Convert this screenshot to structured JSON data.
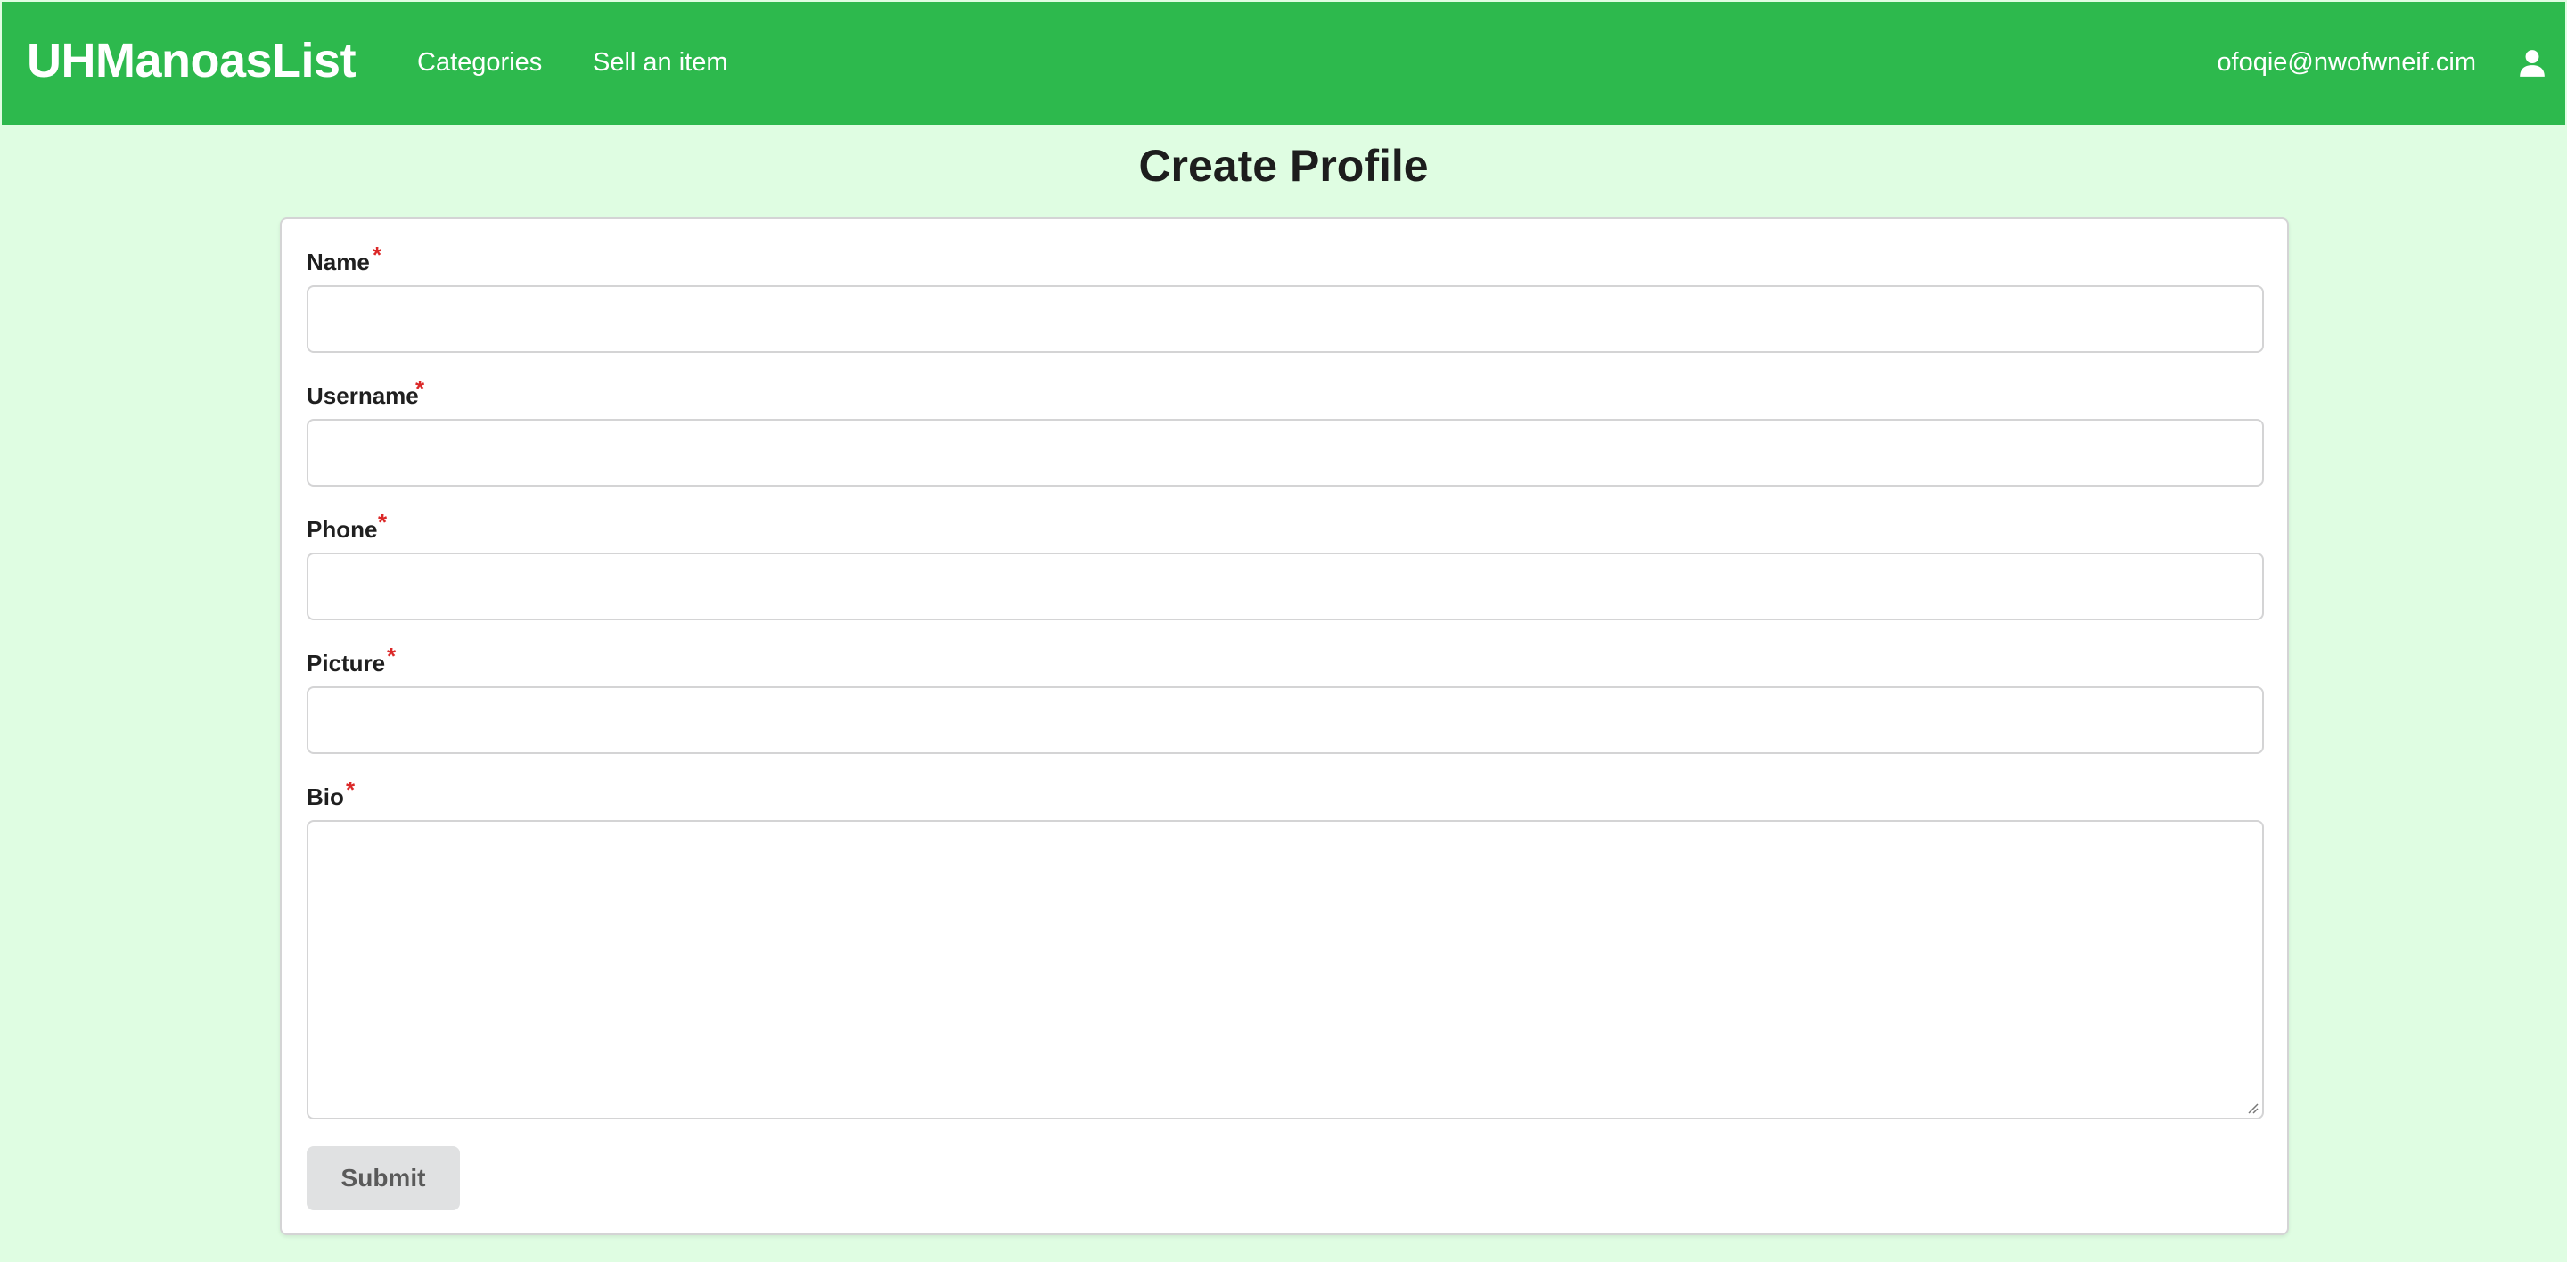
{
  "navbar": {
    "brand": "UHManoasList",
    "links": [
      {
        "label": "Categories"
      },
      {
        "label": "Sell an item"
      }
    ],
    "user_email": "ofoqie@nwofwneif.cim",
    "user_icon": "user-icon"
  },
  "page": {
    "title": "Create Profile"
  },
  "form": {
    "required_marker": "*",
    "fields": [
      {
        "label": "Name",
        "value": ""
      },
      {
        "label": "Username",
        "value": ""
      },
      {
        "label": "Phone",
        "value": ""
      },
      {
        "label": "Picture",
        "value": ""
      },
      {
        "label": "Bio",
        "value": ""
      }
    ],
    "submit_label": "Submit"
  },
  "colors": {
    "navbar": "#2db94d",
    "background": "#dffde2",
    "required": "#db2828",
    "button": "#e0e1e2"
  }
}
